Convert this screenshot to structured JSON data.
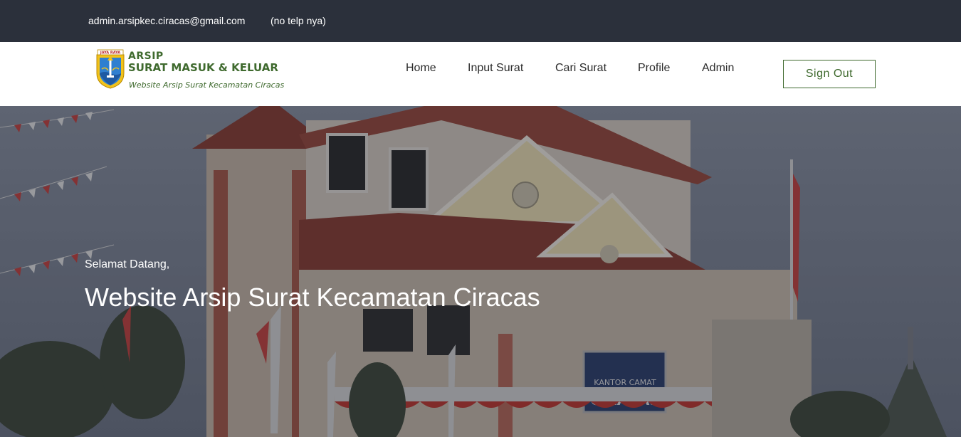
{
  "topbar": {
    "email": "admin.arsipkec.ciracas@gmail.com",
    "phone": "(no telp nya)"
  },
  "logo": {
    "line1": "ARSIP",
    "line2": "SURAT MASUK & KELUAR",
    "tagline": "Website Arsip Surat Kecamatan Ciracas",
    "emblem_text": "JAYA RAYA"
  },
  "nav": {
    "items": [
      {
        "label": "Home"
      },
      {
        "label": "Input Surat"
      },
      {
        "label": "Cari Surat"
      },
      {
        "label": "Profile"
      },
      {
        "label": "Admin"
      }
    ],
    "signout_label": "Sign Out"
  },
  "hero": {
    "greeting": "Selamat Datang,",
    "title": "Website Arsip Surat Kecamatan Ciracas",
    "building_sign_line1": "KANTOR CAMAT",
    "building_sign_line2": "CIRACAS"
  },
  "colors": {
    "topbar_bg": "#2b303b",
    "brand_green": "#3f6a2e",
    "hero_overlay": "rgba(20,24,34,0.38)"
  }
}
